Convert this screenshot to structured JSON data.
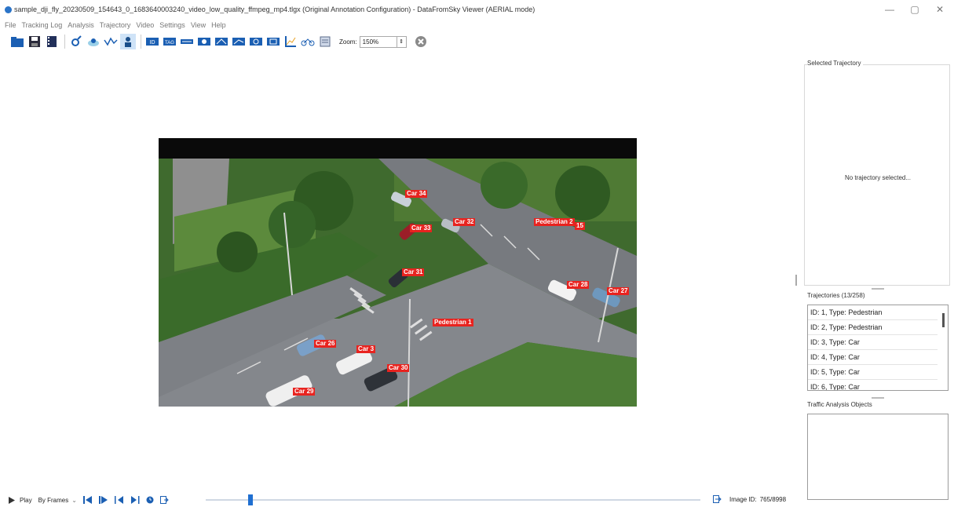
{
  "window": {
    "title": "sample_dji_fly_20230509_154643_0_1683640003240_video_low_quality_ffmpeg_mp4.tlgx (Original Annotation Configuration) - DataFromSky Viewer (AERIAL mode)",
    "minimize_glyph": "—",
    "maximize_glyph": "▢",
    "close_glyph": "✕"
  },
  "menu": [
    "File",
    "Tracking Log",
    "Analysis",
    "Trajectory",
    "Video",
    "Settings",
    "View",
    "Help"
  ],
  "toolbar": {
    "icons": [
      "open-folder-icon",
      "save-icon",
      "film-icon",
      "trajectory-tool-icon",
      "camera-icon",
      "path-icon",
      "person-icon",
      "id-tag-icon",
      "tag-icon",
      "road-bar-icon",
      "gate-icon",
      "region-icon",
      "region-2-icon",
      "region-3-icon",
      "region-4-icon",
      "axis-icon",
      "bicycle-icon",
      "layers-icon"
    ],
    "zoom_label": "Zoom:",
    "zoom_value": "150%",
    "clear_glyph": "✕"
  },
  "video": {
    "labels": [
      {
        "text": "Car 34"
      },
      {
        "text": "Car 32"
      },
      {
        "text": "Car 33"
      },
      {
        "text": "Pedestrian 2"
      },
      {
        "text": "15"
      },
      {
        "text": "Car 31"
      },
      {
        "text": "Car 28"
      },
      {
        "text": "Car 27"
      },
      {
        "text": "Pedestrian 1"
      },
      {
        "text": "Car 26"
      },
      {
        "text": "Car 3"
      },
      {
        "text": "Car 30"
      },
      {
        "text": "Car 29"
      }
    ]
  },
  "right_panel": {
    "selected_trajectory_title": "Selected Trajectory",
    "no_trajectory_text": "No trajectory selected...",
    "trajectories_title": "Trajectories (13/258)",
    "trajectories": [
      "ID: 1, Type: Pedestrian",
      "ID: 2, Type: Pedestrian",
      "ID: 3, Type: Car",
      "ID: 4, Type: Car",
      "ID: 5, Type: Car",
      "ID: 6, Type: Car"
    ],
    "traffic_objects_title": "Traffic Analysis Objects"
  },
  "playbar": {
    "play_label": "Play",
    "mode_label": "By Frames",
    "image_id_label": "Image ID:",
    "image_id_value": "765/8998",
    "progress": 0.086
  },
  "colors": {
    "label_bg": "#e8231f",
    "accent": "#1f6fd1"
  }
}
